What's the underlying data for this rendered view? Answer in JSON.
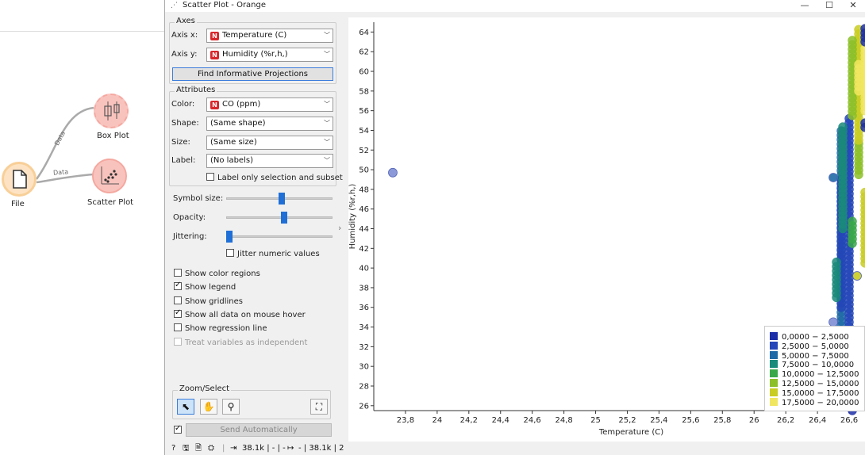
{
  "workflow": {
    "nodes": [
      {
        "label": "File",
        "icon": "document-icon"
      },
      {
        "label": "Box Plot",
        "icon": "box-plot-icon"
      },
      {
        "label": "Scatter Plot",
        "icon": "scatter-plot-icon"
      }
    ],
    "links": [
      "Data",
      "Data"
    ]
  },
  "window": {
    "title": "Scatter Plot - Orange",
    "minimize": "—",
    "maximize": "☐",
    "close": "✕"
  },
  "axes": {
    "group_title": "Axes",
    "x_label": "Axis x:",
    "x_value": "Temperature (C)",
    "y_label": "Axis y:",
    "y_value": "Humidity (%r,h,)",
    "find_button": "Find Informative Projections"
  },
  "attributes": {
    "group_title": "Attributes",
    "color_label": "Color:",
    "color_value": "CO (ppm)",
    "shape_label": "Shape:",
    "shape_value": "(Same shape)",
    "size_label": "Size:",
    "size_value": "(Same size)",
    "label_label": "Label:",
    "label_value": "(No labels)",
    "label_only_selection": "Label only selection and subset"
  },
  "sliders": {
    "symbol_size_label": "Symbol size:",
    "symbol_size_value": 0.52,
    "opacity_label": "Opacity:",
    "opacity_value": 0.55,
    "jittering_label": "Jittering:",
    "jittering_value": 0.0,
    "jitter_numeric": "Jitter numeric values"
  },
  "options": [
    {
      "label": "Show color regions",
      "checked": false,
      "disabled": false
    },
    {
      "label": "Show legend",
      "checked": true,
      "disabled": false
    },
    {
      "label": "Show gridlines",
      "checked": false,
      "disabled": false
    },
    {
      "label": "Show all data on mouse hover",
      "checked": true,
      "disabled": false
    },
    {
      "label": "Show regression line",
      "checked": false,
      "disabled": false
    },
    {
      "label": "Treat variables as independent",
      "checked": false,
      "disabled": true
    }
  ],
  "zoom": {
    "group_title": "Zoom/Select"
  },
  "send": {
    "label": "Send Automatically",
    "checked": true
  },
  "status": {
    "input_text": "38.1k | - | -",
    "output_text": "- | 38.1k | 2"
  },
  "colors": {
    "legend": [
      "#1c2fa8",
      "#2446b8",
      "#1f6aa6",
      "#1a8a7a",
      "#3aa84a",
      "#8cbf28",
      "#c9cc22",
      "#f1e660"
    ]
  },
  "chart_data": {
    "type": "scatter",
    "title": "",
    "xlabel": "Temperature (C)",
    "ylabel": "Humidity (%r,h,)",
    "xlim": [
      23.6,
      26.7
    ],
    "ylim": [
      25.5,
      65
    ],
    "x_ticks": [
      "23,8",
      "24",
      "24,2",
      "24,4",
      "24,6",
      "24,8",
      "25",
      "25,2",
      "25,4",
      "25,6",
      "25,8",
      "26",
      "26,2",
      "26,4",
      "26,6"
    ],
    "y_ticks": [
      "26",
      "28",
      "30",
      "32",
      "34",
      "36",
      "38",
      "40",
      "42",
      "44",
      "46",
      "48",
      "50",
      "52",
      "54",
      "56",
      "58",
      "60",
      "62",
      "64"
    ],
    "color_by": "CO (ppm)",
    "legend": [
      "0,0000 − 2,5000",
      "2,5000 − 5,0000",
      "5,0000 − 7,5000",
      "7,5000 − 10,0000",
      "10,0000 − 12,5000",
      "12,5000 − 15,0000",
      "15,0000 − 17,5000",
      "17,5000 − 20,0000"
    ],
    "legend_placement": "bottom-right",
    "grid": false,
    "points": [
      {
        "x": 23.72,
        "y": 49.7,
        "c": 1
      },
      {
        "x": 26.5,
        "y": 49.2,
        "c": 2
      },
      {
        "x": 26.5,
        "y": 34.5,
        "c": 1
      },
      {
        "x": 26.5,
        "y": 27.0,
        "c": 1
      },
      {
        "x": 26.65,
        "y": 39.2,
        "c": 6
      }
    ],
    "columns": [
      {
        "x": 26.55,
        "y_from": 26.5,
        "y_to": 54.0,
        "c": 2
      },
      {
        "x": 26.6,
        "y_from": 30.0,
        "y_to": 55.5,
        "c": 1
      },
      {
        "x": 26.55,
        "y_from": 36.0,
        "y_to": 49.5,
        "c": 1
      },
      {
        "x": 26.52,
        "y_from": 37.0,
        "y_to": 41.0,
        "c": 3
      },
      {
        "x": 26.56,
        "y_from": 44.0,
        "y_to": 54.5,
        "c": 3
      },
      {
        "x": 26.62,
        "y_from": 42.5,
        "y_to": 45.0,
        "c": 4
      },
      {
        "x": 26.66,
        "y_from": 49.5,
        "y_to": 53.0,
        "c": 5
      },
      {
        "x": 26.66,
        "y_from": 53.0,
        "y_to": 64.5,
        "c": 6
      },
      {
        "x": 26.62,
        "y_from": 55.5,
        "y_to": 63.5,
        "c": 5
      },
      {
        "x": 26.7,
        "y_from": 56.0,
        "y_to": 62.5,
        "c": 7
      },
      {
        "x": 26.66,
        "y_from": 58.0,
        "y_to": 61.0,
        "c": 7
      },
      {
        "x": 26.7,
        "y_from": 63.0,
        "y_to": 64.5,
        "c": 0
      },
      {
        "x": 26.7,
        "y_from": 54.3,
        "y_to": 55.0,
        "c": 0
      },
      {
        "x": 26.7,
        "y_from": 40.5,
        "y_to": 48.0,
        "c": 6
      },
      {
        "x": 26.62,
        "y_from": 24.0,
        "y_to": 30.0,
        "c": 0
      }
    ]
  }
}
